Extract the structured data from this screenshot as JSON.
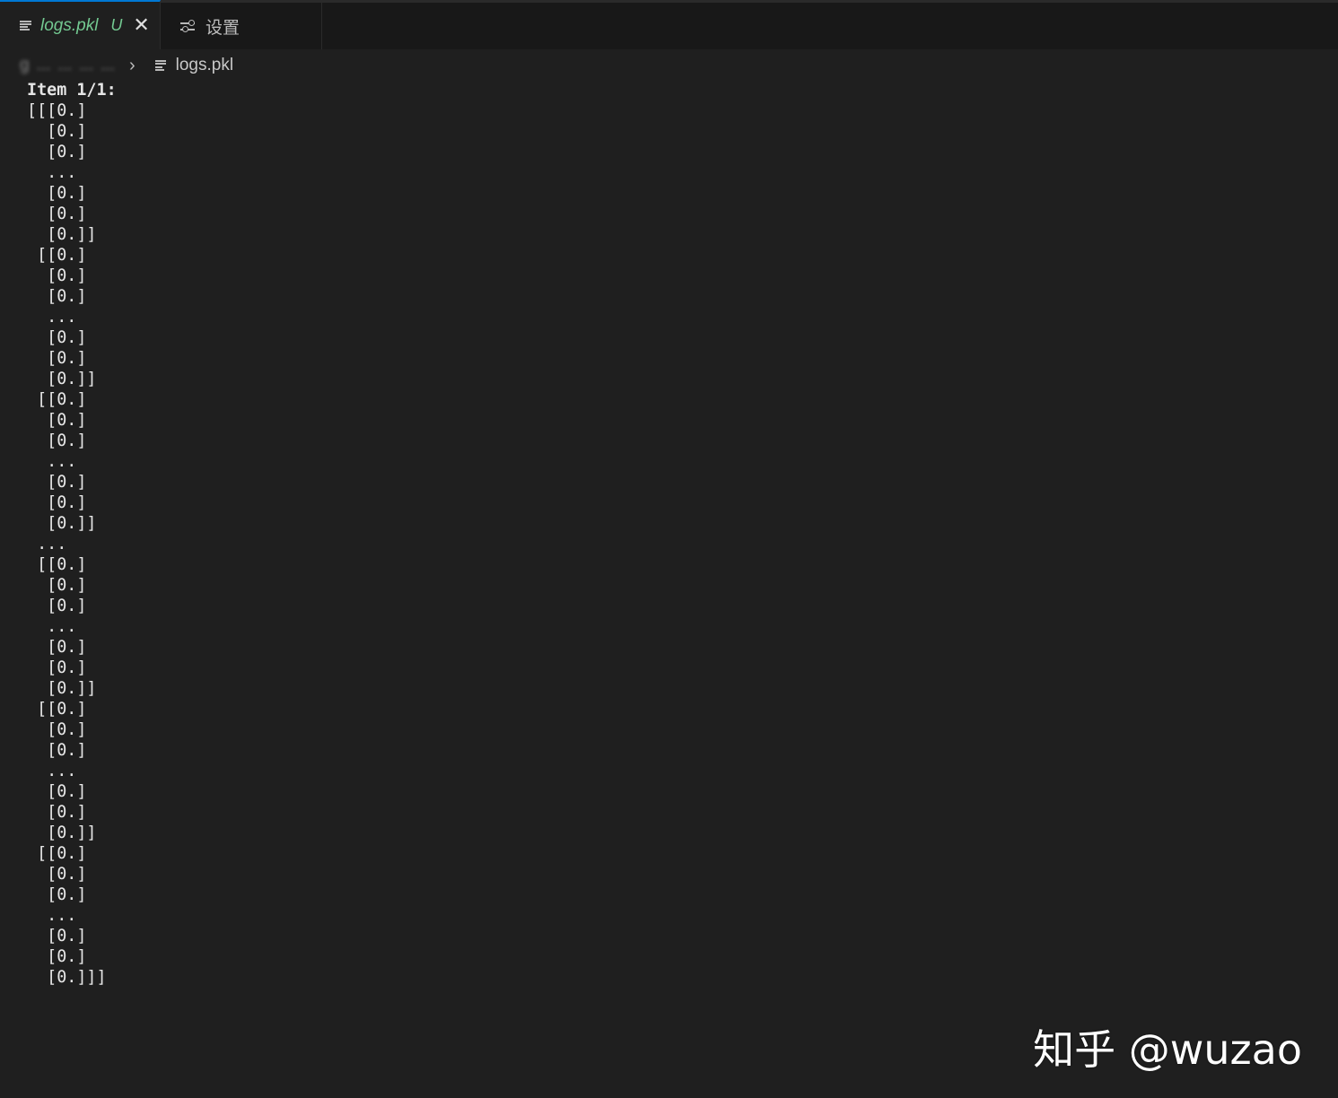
{
  "tabs": [
    {
      "title": "logs.pkl",
      "badge": "U",
      "close": "✕",
      "active": true,
      "icon": "file-lines-icon"
    },
    {
      "title": "设置",
      "active": false,
      "icon": "settings-sliders-icon"
    }
  ],
  "breadcrumb": {
    "obscured": [
      "g",
      "...",
      "...",
      "...",
      "..."
    ],
    "separator": "›",
    "file": "logs.pkl"
  },
  "editor": {
    "lines": [
      "Item 1/1:",
      "[[[0.]",
      "  [0.]",
      "  [0.]",
      "  ...",
      "  [0.]",
      "  [0.]",
      "  [0.]]",
      " [[0.]",
      "  [0.]",
      "  [0.]",
      "  ...",
      "  [0.]",
      "  [0.]",
      "  [0.]]",
      " [[0.]",
      "  [0.]",
      "  [0.]",
      "  ...",
      "  [0.]",
      "  [0.]",
      "  [0.]]",
      " ...",
      " [[0.]",
      "  [0.]",
      "  [0.]",
      "  ...",
      "  [0.]",
      "  [0.]",
      "  [0.]]",
      " [[0.]",
      "  [0.]",
      "  [0.]",
      "  ...",
      "  [0.]",
      "  [0.]",
      "  [0.]]",
      " [[0.]",
      "  [0.]",
      "  [0.]",
      "  ...",
      "  [0.]",
      "  [0.]",
      "  [0.]]]"
    ]
  },
  "watermark": "知乎 @wuzao",
  "colors": {
    "editor_bg": "#1f1f1f",
    "tabbar_bg": "#181818",
    "active_tab_accent": "#0078d4",
    "modified_file": "#73c991",
    "text": "#e6e6e6"
  }
}
